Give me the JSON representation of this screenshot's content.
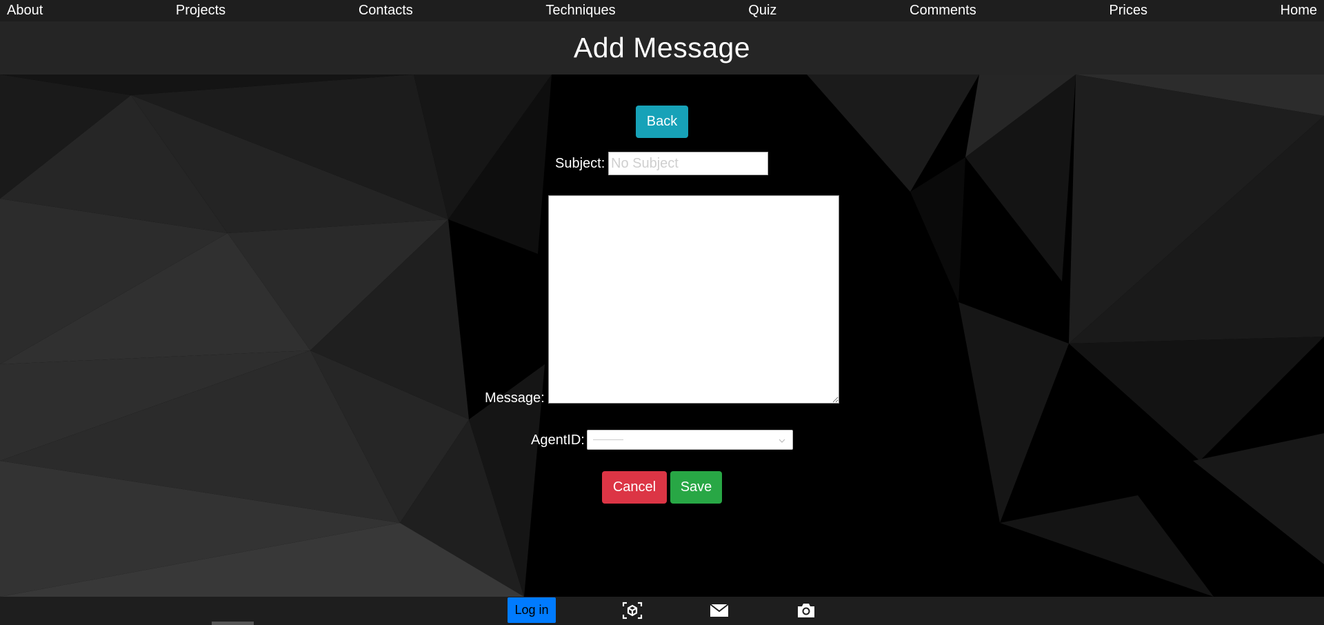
{
  "nav": {
    "items": [
      {
        "label": "About"
      },
      {
        "label": "Projects"
      },
      {
        "label": "Contacts"
      },
      {
        "label": "Techniques"
      },
      {
        "label": "Quiz"
      },
      {
        "label": "Comments"
      },
      {
        "label": "Prices"
      },
      {
        "label": "Home"
      }
    ]
  },
  "header": {
    "title": "Add Message"
  },
  "form": {
    "back_label": "Back",
    "subject_label": "Subject:",
    "subject_placeholder": "No Subject",
    "subject_value": "",
    "message_label": "Message:",
    "message_value": "",
    "agent_label": "AgentID:",
    "agent_selected": "",
    "cancel_label": "Cancel",
    "save_label": "Save"
  },
  "footer": {
    "login_label": "Log in",
    "icons": [
      "ar-cube-icon",
      "mail-icon",
      "camera-icon"
    ]
  },
  "colors": {
    "nav_bg": "#1e1e1e",
    "header_bg": "#252525",
    "back_button": "#17a2b8",
    "cancel_button": "#dc3545",
    "save_button": "#28a745",
    "login_button": "#007bff"
  }
}
